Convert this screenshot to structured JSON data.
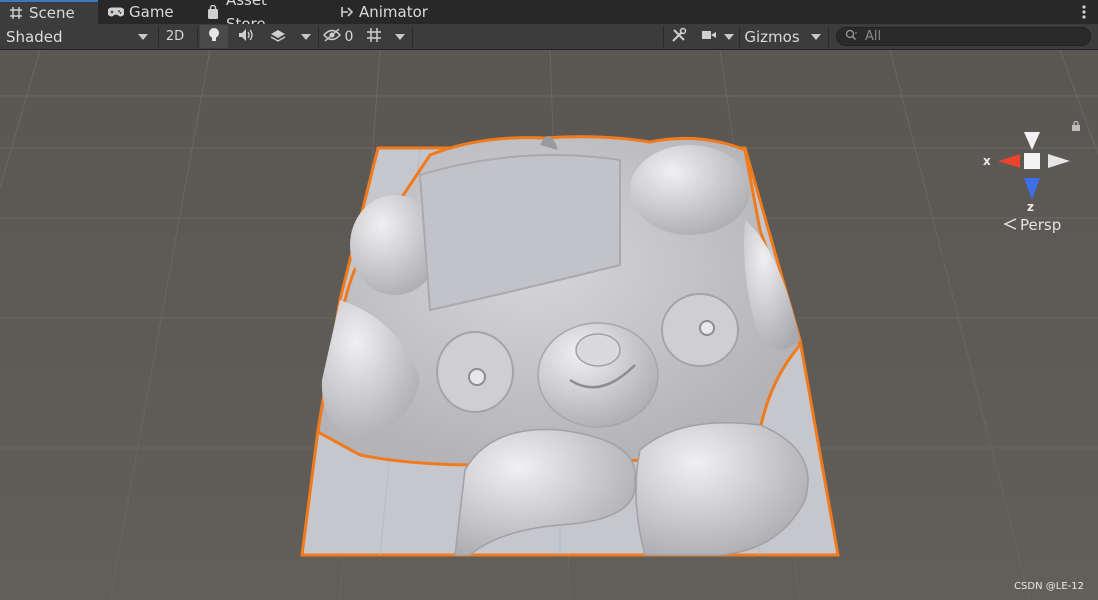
{
  "tabs": [
    {
      "label": "Scene",
      "icon": "grid-icon",
      "active": true
    },
    {
      "label": "Game",
      "icon": "gamepad-icon",
      "active": false
    },
    {
      "label": "Asset Store",
      "icon": "shopping-bag-icon",
      "active": false
    },
    {
      "label": "Animator",
      "icon": "animator-icon",
      "active": false
    }
  ],
  "toolbar": {
    "draw_mode": "Shaded",
    "mode_2d": "2D",
    "hidden_count": "0",
    "gizmos": "Gizmos",
    "search_placeholder": "All"
  },
  "viewport": {
    "axis_x": "x",
    "axis_z": "z",
    "projection": "Persp",
    "watermark": "CSDN @LE-12",
    "selection_color": "#f07a1e",
    "background_color": "#5e5a55"
  }
}
